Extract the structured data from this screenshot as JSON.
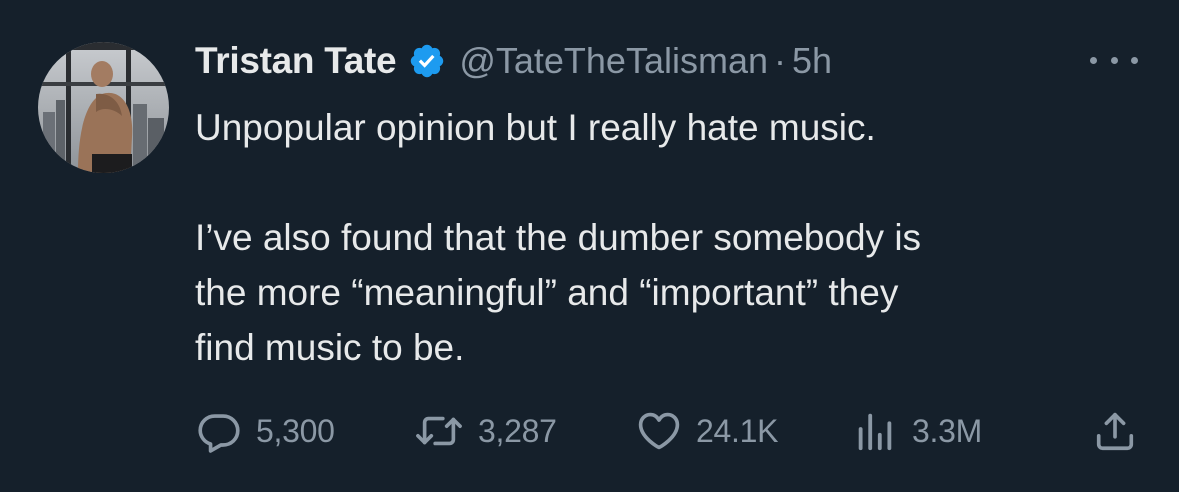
{
  "tweet": {
    "author": {
      "name": "Tristan Tate",
      "handle": "@TateTheTalisman",
      "verified_icon": "verified-badge-icon",
      "avatar_icon": "avatar"
    },
    "separator": "·",
    "time": "5h",
    "body": {
      "paragraph1": "Unpopular opinion but I really hate music.",
      "paragraph2_line1": "I’ve also found that the dumber somebody is",
      "paragraph2_line2": "the more “meaningful” and “important” they",
      "paragraph2_line3": "find music to be."
    },
    "actions": {
      "replies": "5,300",
      "reposts": "3,287",
      "likes": "24.1K",
      "views": "3.3M"
    },
    "icons": {
      "reply": "reply-icon",
      "repost": "repost-icon",
      "like": "heart-icon",
      "views": "analytics-icon",
      "share": "share-icon",
      "more": "more-icon"
    }
  },
  "colors": {
    "background": "#15202b",
    "text_primary": "#e7e9ea",
    "text_secondary": "#8b98a5",
    "verified_blue": "#1d9bf0"
  }
}
